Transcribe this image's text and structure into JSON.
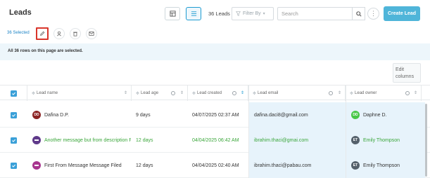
{
  "header": {
    "title": "Leads",
    "leads_count": "36 Leads",
    "filter_label": "Filter By",
    "search_placeholder": "Search",
    "create_button": "Create Lead",
    "icons": {
      "card_view": "card-view-icon",
      "list_view": "list-view-icon",
      "search": "search-icon",
      "more": "more-vertical-icon",
      "filter": "filter-icon"
    }
  },
  "actionbar": {
    "selected_label": "36 Selected",
    "actions": [
      "edit-icon",
      "user-icon",
      "trash-icon",
      "mail-icon"
    ]
  },
  "banner": {
    "text": "All 36 rows on this page are selected."
  },
  "edit_columns": "Edit columns",
  "table": {
    "columns": [
      "Lead name",
      "Lead age",
      "Lead created",
      "Lead email",
      "Lead owner"
    ],
    "rows": [
      {
        "name": "Dafina D.P.",
        "avatar_initials": "DD",
        "avatar_color": "#8b2323",
        "age": "9 days",
        "created": "04/07/2025 02:37 AM",
        "email": "dafina.daci8@gmail.com",
        "owner": "Daphne D.",
        "owner_initials": "DD",
        "owner_color": "#47c747",
        "highlight": false
      },
      {
        "name": "Another message but from description F",
        "avatar_initials": "",
        "avatar_color": "#5f3a8a",
        "age": "12 days",
        "created": "04/04/2025 06:42 AM",
        "email": "ibrahim.thaci@gmai.com",
        "owner": "Emily Thompson",
        "owner_initials": "ET",
        "owner_color": "#54606b",
        "highlight": true
      },
      {
        "name": "First From Message Message Filed",
        "avatar_initials": "",
        "avatar_color": "#a8358f",
        "age": "12 days",
        "created": "04/04/2025 02:40 AM",
        "email": "ibrahim.thaci@pabau.com",
        "owner": "Emily Thompson",
        "owner_initials": "ET",
        "owner_color": "#54606b",
        "highlight": false
      }
    ]
  },
  "colors": {
    "accent": "#1d9bd1",
    "create_button": "#4fb5d9",
    "selected_banner": "#edf6fb",
    "highlight_text": "#3aa63a",
    "edit_highlight": "#d9352b"
  }
}
